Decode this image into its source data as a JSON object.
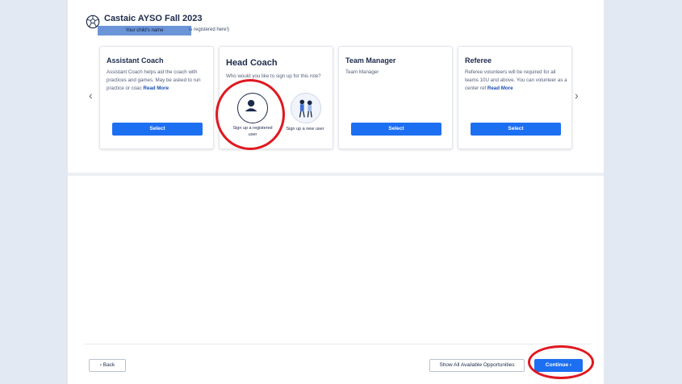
{
  "header": {
    "org_title": "Castaic AYSO Fall 2023",
    "child_name": "Your child's name",
    "registered_text": "is registered here!)"
  },
  "nav": {
    "prev_label": "‹",
    "next_label": "›"
  },
  "cards": {
    "assistant_coach": {
      "title": "Assistant Coach",
      "description": "Assistant Coach helps aid the coach with practices and games. May be asked to run practice or coac",
      "read_more": "Read More",
      "select_label": "Select"
    },
    "head_coach": {
      "title": "Head Coach",
      "description": "Who would you like to sign up for this role?",
      "option_registered": "Sign up a registered user",
      "option_new": "Sign up a new user"
    },
    "team_manager": {
      "title": "Team Manager",
      "description": "Team Manager",
      "select_label": "Select"
    },
    "referee": {
      "title": "Referee",
      "description": "Referee volunteers will be required for all teams 10U and above. You can volunteer as a center ref",
      "read_more": "Read More",
      "select_label": "Select"
    }
  },
  "footer": {
    "back_label": "Back",
    "show_all_label": "Show All Available Opportunities",
    "continue_label": "Continue"
  },
  "colors": {
    "accent": "#1d6ff2",
    "annotation": "#e01820",
    "background": "#e3e9f2"
  },
  "icons": [
    "soccer-ball-icon",
    "user-icon",
    "new-user-illustration-icon",
    "chevron-left-icon",
    "chevron-right-icon"
  ]
}
